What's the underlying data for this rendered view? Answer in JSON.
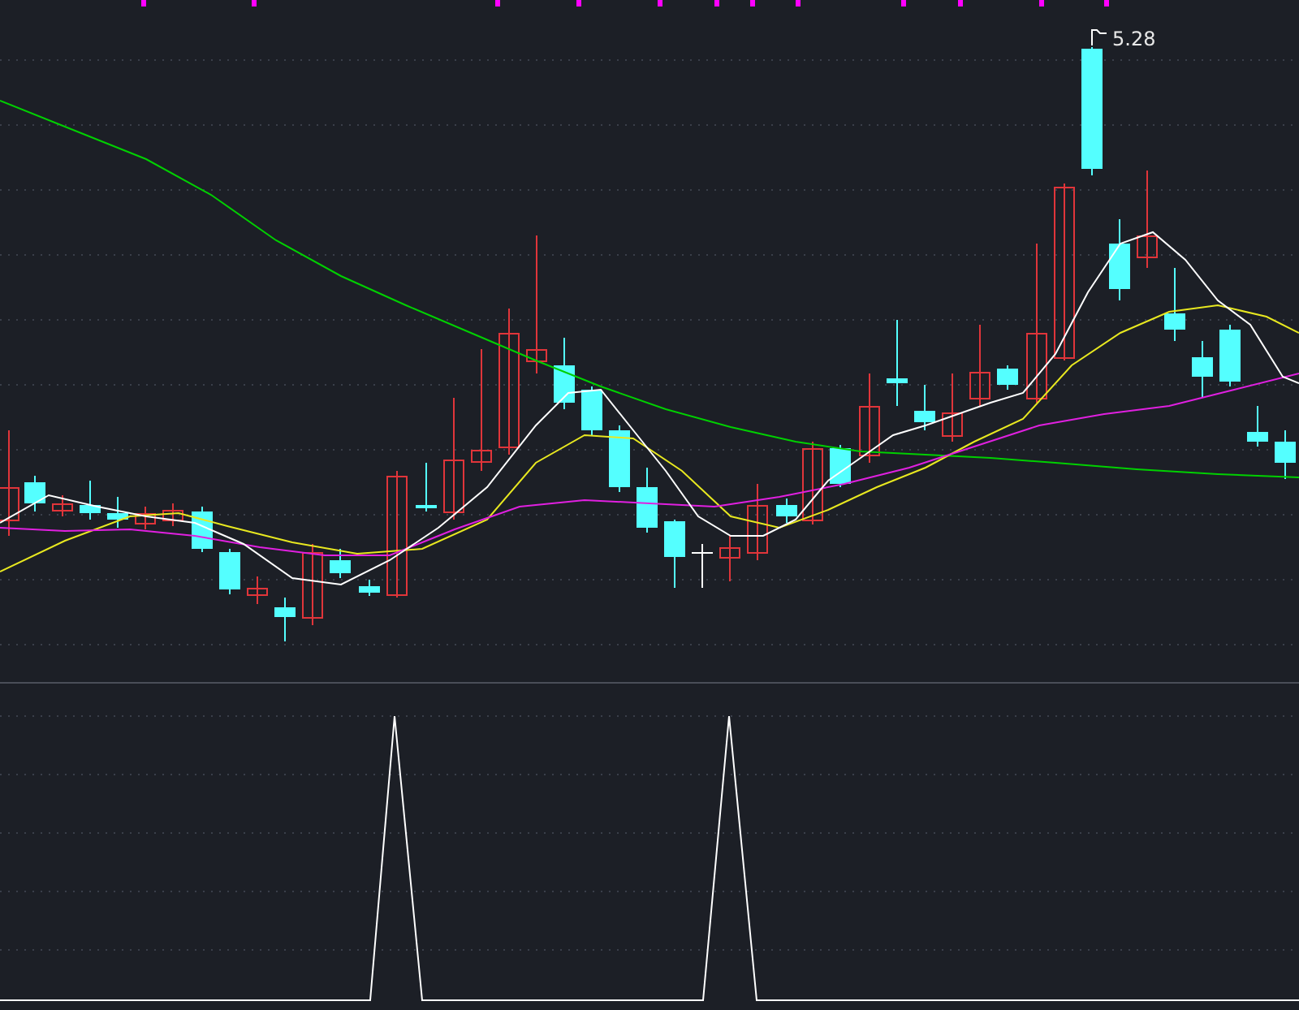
{
  "price_chart": {
    "high_label": "5.28"
  }
}
